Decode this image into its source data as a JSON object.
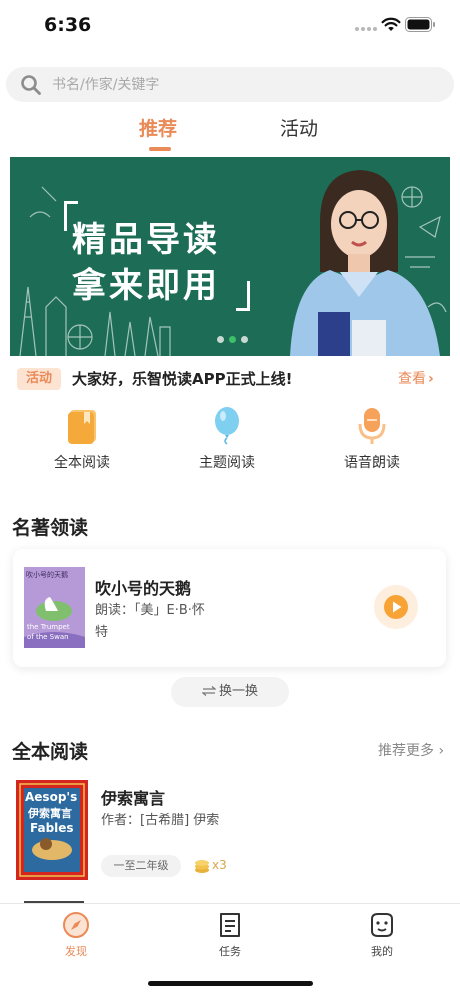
{
  "status_bar": {
    "time": "6:36"
  },
  "search": {
    "placeholder": "书名/作家/关键字",
    "value": ""
  },
  "top_tabs": [
    {
      "label": "推荐",
      "active": true
    },
    {
      "label": "活动",
      "active": false
    }
  ],
  "banner": {
    "line1": "精品导读",
    "line2": "拿来即用",
    "dots": 3,
    "active_dot": 2,
    "background_color": "#1d6c56"
  },
  "notice": {
    "badge": "活动",
    "text": "大家好，乐智悦读APP正式上线!",
    "more": "查看"
  },
  "categories": [
    {
      "label": "全本阅读",
      "icon": "book-icon"
    },
    {
      "label": "主题阅读",
      "icon": "balloon-icon"
    },
    {
      "label": "语音朗读",
      "icon": "microphone-icon"
    }
  ],
  "famous": {
    "title": "名著领读",
    "book": {
      "name": "吹小号的天鹅",
      "reader_line1": "朗读：「美」E·B·怀",
      "reader_line2": "特",
      "cover_title": "吹小号的天鹅",
      "cover_subtitle_en1": "the Trumpet",
      "cover_subtitle_en2": "of the Swan"
    },
    "swap_label": "换一换"
  },
  "full_reading": {
    "title": "全本阅读",
    "more": "推荐更多",
    "books": [
      {
        "title": "伊索寓言",
        "author": "作者：[古希腊] 伊索",
        "grade": "一至二年级",
        "coins": "x3",
        "cover_en_top": "Aesop's",
        "cover_cn": "伊索寓言",
        "cover_en_bottom": "Fables"
      }
    ]
  },
  "tab_bar": [
    {
      "label": "发现",
      "icon": "compass-icon",
      "active": true
    },
    {
      "label": "任务",
      "icon": "task-list-icon",
      "active": false
    },
    {
      "label": "我的",
      "icon": "profile-face-icon",
      "active": false
    }
  ],
  "colors": {
    "accent": "#e98a57",
    "banner_green": "#1d6c56",
    "coin_gold": "#d9a64a"
  }
}
